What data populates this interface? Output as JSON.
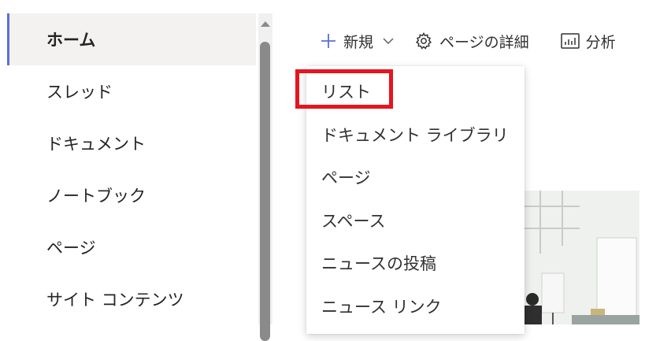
{
  "left_nav": {
    "items": [
      {
        "label": "ホーム",
        "active": true
      },
      {
        "label": "スレッド",
        "active": false
      },
      {
        "label": "ドキュメント",
        "active": false
      },
      {
        "label": "ノートブック",
        "active": false
      },
      {
        "label": "ページ",
        "active": false
      },
      {
        "label": "サイト コンテンツ",
        "active": false
      }
    ]
  },
  "command_bar": {
    "new_label": "新規",
    "page_details_label": "ページの詳細",
    "analytics_label": "分析"
  },
  "new_menu": {
    "items": [
      "リスト",
      "ドキュメント ライブラリ",
      "ページ",
      "スペース",
      "ニュースの投稿",
      "ニュース リンク"
    ],
    "highlighted_item": "リスト"
  },
  "colors": {
    "accent": "#5b6fd6",
    "highlight_border": "#e8141e",
    "active_background": "#f3f2f1",
    "text": "#242424"
  },
  "icons": [
    "plus-icon",
    "chevron-down-icon",
    "gear-icon",
    "analytics-icon",
    "scroll-up-arrow-icon"
  ]
}
